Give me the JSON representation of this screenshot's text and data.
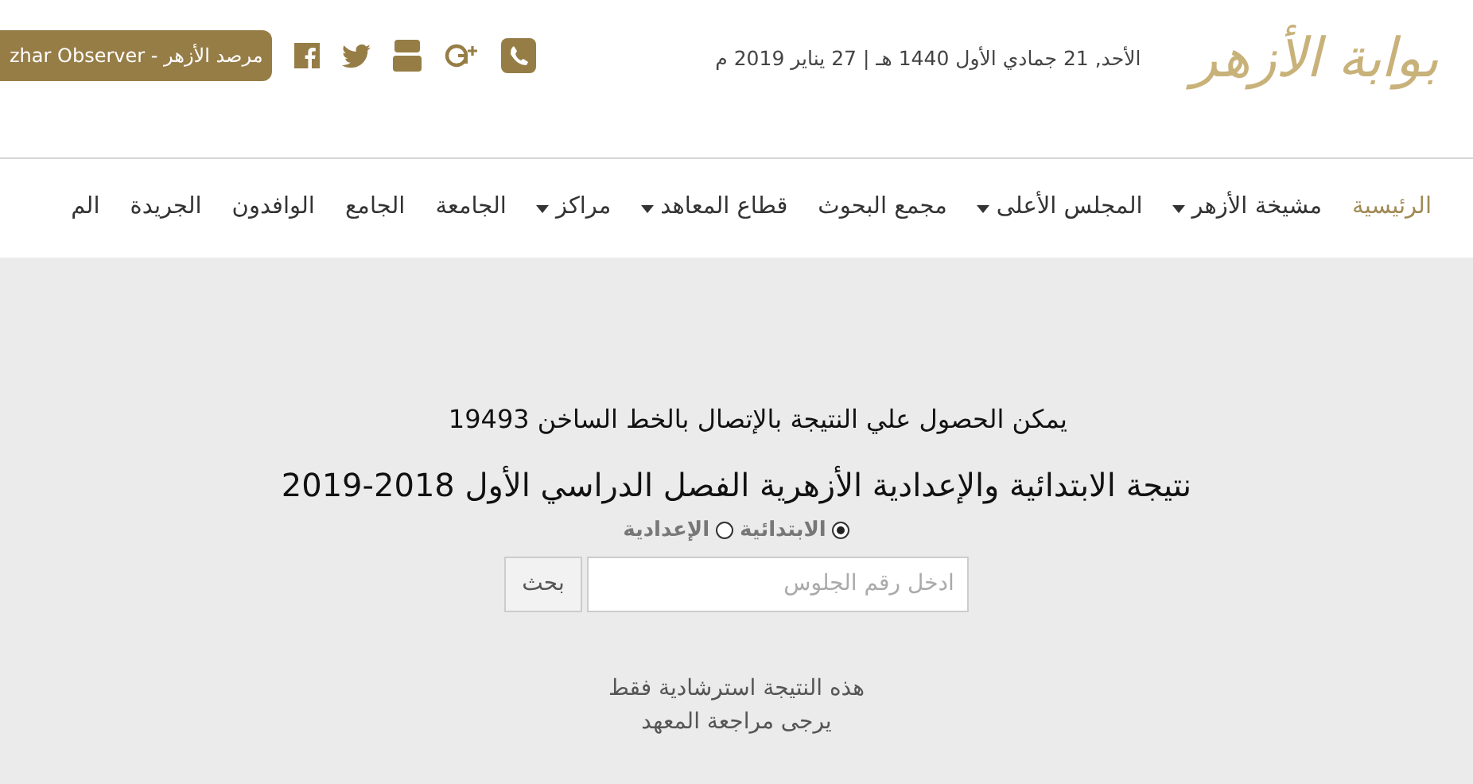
{
  "header": {
    "logo": "بوابة الأزهر",
    "date": "الأحد, 21 جمادي الأول 1440 هـ | 27 يناير 2019 م",
    "social": [
      {
        "kind": "phone"
      },
      {
        "kind": "gplus"
      },
      {
        "kind": "video"
      },
      {
        "kind": "twitter"
      },
      {
        "kind": "facebook"
      }
    ],
    "observer_button": "مرصد الأزهر - zhar Observer"
  },
  "nav": [
    {
      "label": "الرئيسية",
      "selected": true,
      "dropdown": false
    },
    {
      "label": "مشيخة الأزهر",
      "selected": false,
      "dropdown": true
    },
    {
      "label": "المجلس الأعلى",
      "selected": false,
      "dropdown": true
    },
    {
      "label": "مجمع البحوث",
      "selected": false,
      "dropdown": false
    },
    {
      "label": "قطاع المعاهد",
      "selected": false,
      "dropdown": true
    },
    {
      "label": "مراكز",
      "selected": false,
      "dropdown": true
    },
    {
      "label": "الجامعة",
      "selected": false,
      "dropdown": false
    },
    {
      "label": "الجامع",
      "selected": false,
      "dropdown": false
    },
    {
      "label": "الوافدون",
      "selected": false,
      "dropdown": false
    },
    {
      "label": "الجريدة",
      "selected": false,
      "dropdown": false
    },
    {
      "label": "الم",
      "selected": false,
      "dropdown": false
    }
  ],
  "main": {
    "hotline": "يمكن الحصول علي النتيجة بالإتصال بالخط الساخن 19493",
    "title": "نتيجة الابتدائية والإعدادية الأزهرية الفصل الدراسي الأول 2018-2019",
    "stages": [
      {
        "label": "الابتدائية",
        "selected": true
      },
      {
        "label": "الإعدادية",
        "selected": false
      }
    ],
    "search": {
      "placeholder": "ادخل رقم الجلوس",
      "button": "بحث"
    },
    "notes": [
      "هذه النتيجة استرشادية فقط",
      "يرجى مراجعة المعهد"
    ]
  }
}
